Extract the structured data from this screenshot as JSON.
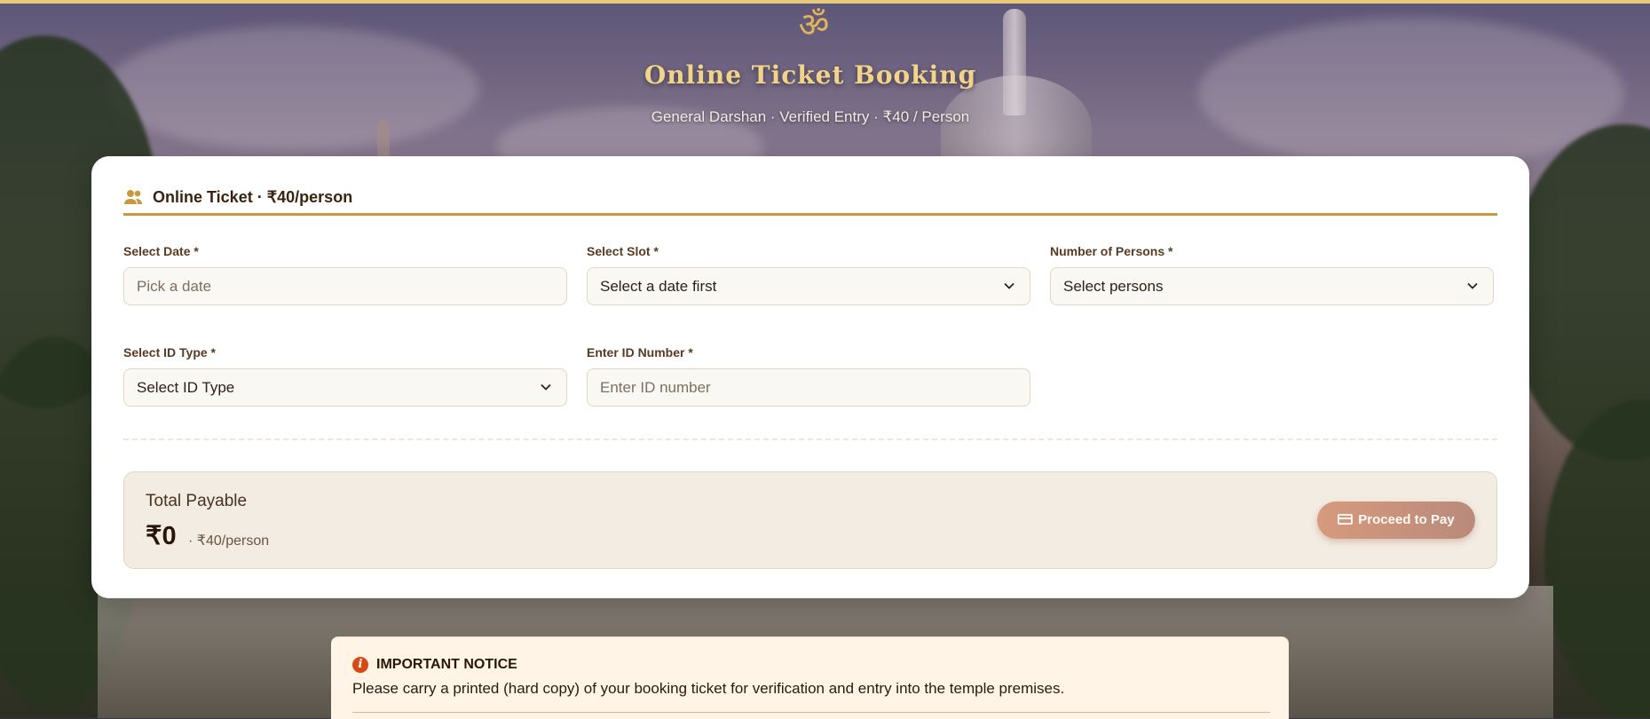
{
  "hero": {
    "symbol": "ॐ",
    "title": "Online Ticket Booking",
    "subtitle": "General Darshan · Verified Entry · ₹40 / Person"
  },
  "card": {
    "title": "Online Ticket · ₹40/person",
    "fields": {
      "date": {
        "label": "Select Date *",
        "placeholder": "Pick a date"
      },
      "slot": {
        "label": "Select Slot *",
        "value": "Select a date first"
      },
      "persons": {
        "label": "Number of Persons *",
        "value": "Select persons"
      },
      "id_type": {
        "label": "Select ID Type *",
        "value": "Select ID Type"
      },
      "id_number": {
        "label": "Enter ID Number *",
        "placeholder": "Enter ID number"
      }
    },
    "total": {
      "label": "Total Payable",
      "amount": "₹0",
      "rate": "· ₹40/person",
      "pay_button": "Proceed to Pay"
    }
  },
  "notice": {
    "icon": "i",
    "title": "IMPORTANT NOTICE",
    "text": "Please carry a printed (hard copy) of your booking ticket for verification and entry into the temple premises."
  },
  "colors": {
    "accent_gold": "#c9993f",
    "title_gold": "#f2d38a",
    "pay_button": "#d79a7d",
    "notice_icon": "#d64a17"
  }
}
